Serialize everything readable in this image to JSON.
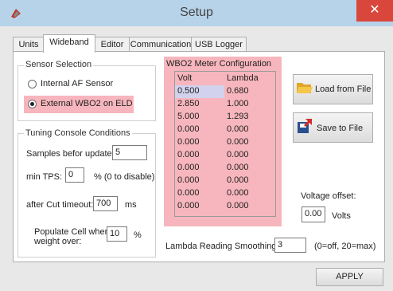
{
  "window": {
    "title": "Setup",
    "close_glyph": "✕"
  },
  "tabs": [
    {
      "label": "Units",
      "active": false
    },
    {
      "label": "Wideband",
      "active": true
    },
    {
      "label": "Editor",
      "active": false
    },
    {
      "label": "Communication",
      "active": false
    },
    {
      "label": "USB Logger",
      "active": false
    }
  ],
  "sensor_selection": {
    "title": "Sensor Selection",
    "options": [
      {
        "label": "Internal AF Sensor",
        "selected": false
      },
      {
        "label": "External WBO2 on ELD",
        "selected": true
      }
    ]
  },
  "tuning": {
    "title": "Tuning Console  Conditions",
    "samples_label": "Samples befor update:",
    "samples_value": "5",
    "min_tps_label": "min TPS:",
    "min_tps_value": "0",
    "min_tps_hint": "% (0 to disable)",
    "after_cut_label": "after Cut timeout:",
    "after_cut_value": "700",
    "after_cut_unit": "ms",
    "populate_label_1": "Populate Cell when",
    "populate_label_2": "weight over:",
    "populate_value": "10",
    "populate_unit": "%"
  },
  "wbo2": {
    "title": "WBO2 Meter Configuration",
    "headers": [
      "Volt",
      "Lambda"
    ],
    "rows": [
      [
        "0.500",
        "0.680"
      ],
      [
        "2.850",
        "1.000"
      ],
      [
        "5.000",
        "1.293"
      ],
      [
        "0.000",
        "0.000"
      ],
      [
        "0.000",
        "0.000"
      ],
      [
        "0.000",
        "0.000"
      ],
      [
        "0.000",
        "0.000"
      ],
      [
        "0.000",
        "0.000"
      ],
      [
        "0.000",
        "0.000"
      ],
      [
        "0.000",
        "0.000"
      ]
    ]
  },
  "buttons": {
    "load": "Load from File",
    "save": "Save to File",
    "apply": "APPLY"
  },
  "voltage_offset": {
    "label": "Voltage offset:",
    "value": "0.00",
    "unit": "Volts"
  },
  "smoothing": {
    "label": "Lambda Reading Smoothing:",
    "value": "3",
    "hint": "(0=off, 20=max)"
  },
  "colors": {
    "titlebar": "#b7d3ea",
    "close": "#d9473c",
    "highlight": "#f7b6bd",
    "selected_cell": "#d2d2ee"
  }
}
